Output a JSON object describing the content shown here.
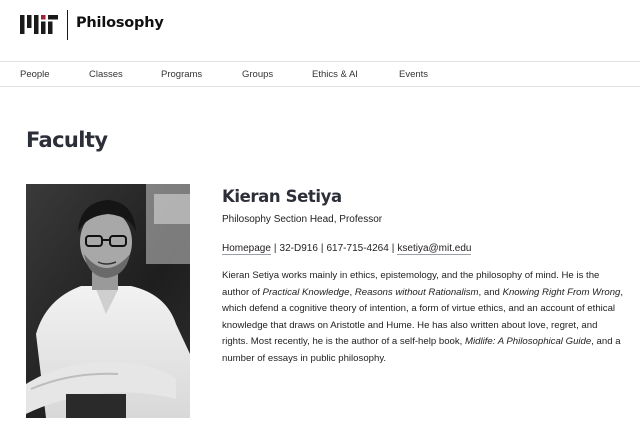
{
  "header": {
    "logo_text": "MIT",
    "site_name": "Philosophy"
  },
  "nav": {
    "items": [
      {
        "label": "People"
      },
      {
        "label": "Classes"
      },
      {
        "label": "Programs"
      },
      {
        "label": "Groups"
      },
      {
        "label": "Ethics & AI"
      },
      {
        "label": "Events"
      }
    ]
  },
  "page": {
    "title": "Faculty"
  },
  "profile": {
    "name": "Kieran Setiya",
    "role": "Philosophy Section Head, Professor",
    "homepage_label": "Homepage",
    "separator": "|",
    "office": "32-D916",
    "phone": "617-715-4264",
    "email": "ksetiya@mit.edu",
    "bio": {
      "p1": "Kieran Setiya works mainly in ethics, epistemology, and the philosophy of mind. He is the author of ",
      "book1": "Practical Knowledge",
      "p2": ", ",
      "book2": "Reasons without Rationalism",
      "p3": ", and ",
      "book3": "Knowing Right From Wrong",
      "p4": ", which defend a cognitive theory of intention, a form of virtue ethics, and an account of ethical knowledge that draws on Aristotle and Hume. He has also written about love, regret, and rights. Most recently, he is the author of a self-help book, ",
      "book4": "Midlife: A Philosophical Guide",
      "p5": ", and a number of essays in public philosophy."
    }
  },
  "colors": {
    "title": "#2d2f38",
    "mit_red": "#a31f34",
    "text": "#222222",
    "nav_border": "#e2e2e2"
  }
}
